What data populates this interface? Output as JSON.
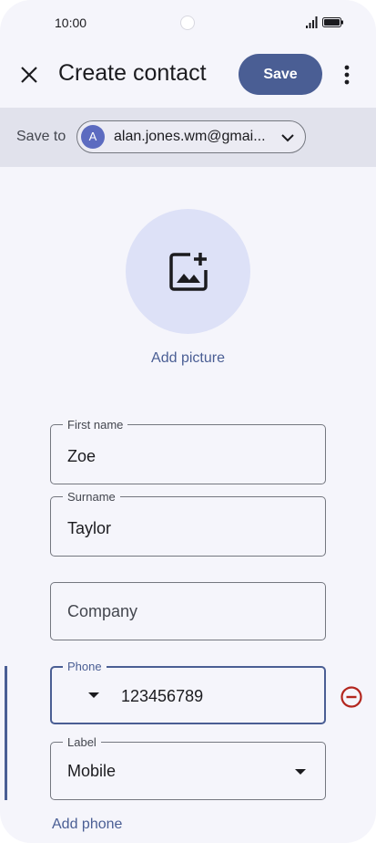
{
  "status_bar": {
    "time": "10:00",
    "icons": [
      "signal-icon",
      "battery-icon"
    ]
  },
  "app_bar": {
    "close_icon": "close-icon",
    "title": "Create contact",
    "save_label": "Save",
    "more_icon": "more-vert-icon"
  },
  "save_to": {
    "label": "Save to",
    "avatar_letter": "A",
    "account": "alan.jones.wm@gmai...",
    "chevron_icon": "chevron-down-icon"
  },
  "picture": {
    "icon": "add-photo-icon",
    "label": "Add picture"
  },
  "fields": {
    "first_name": {
      "label": "First name",
      "value": "Zoe"
    },
    "surname": {
      "label": "Surname",
      "value": "Taylor"
    },
    "company": {
      "placeholder": "Company"
    },
    "phone": {
      "label": "Phone",
      "value": "123456789"
    },
    "phone_label": {
      "label": "Label",
      "value": "Mobile"
    }
  },
  "add_phone": "Add phone",
  "colors": {
    "accent": "#4a5e94",
    "remove": "#b3261e",
    "background": "#f5f5fb"
  }
}
